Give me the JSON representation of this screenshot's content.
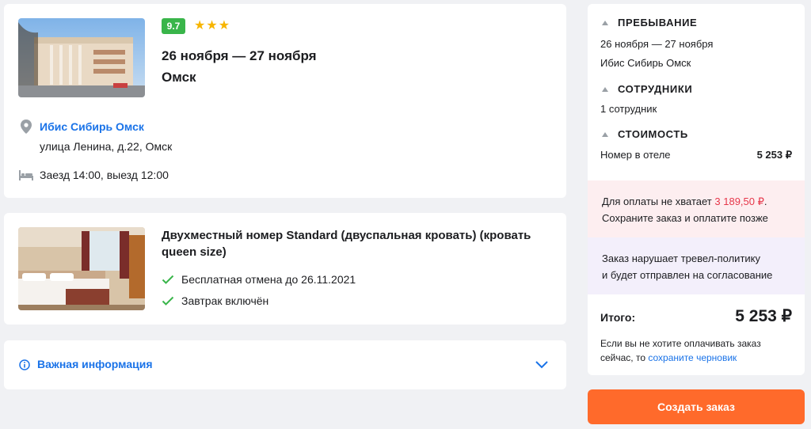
{
  "hotel": {
    "rating": "9.7",
    "stars": 3,
    "dates": "26 ноября — 27 ноября",
    "city": "Омск",
    "name": "Ибис Сибирь Омск",
    "address": "улица Ленина, д.22, Омск",
    "checkin": "Заезд 14:00, выезд 12:00"
  },
  "room": {
    "title": "Двухместный номер Standard (двуспальная кровать) (кровать queen size)",
    "features": [
      "Бесплатная отмена до 26.11.2021",
      "Завтрак включён"
    ]
  },
  "info": {
    "label": "Важная информация"
  },
  "summary": {
    "stay_heading": "ПРЕБЫВАНИЕ",
    "stay_dates": "26 ноября — 27 ноября",
    "stay_hotel": "Ибис Сибирь Омск",
    "staff_heading": "СОТРУДНИКИ",
    "staff_count": "1 сотрудник",
    "cost_heading": "СТОИМОСТЬ",
    "cost_label": "Номер в отеле",
    "cost_value": "5 253 ₽",
    "insufficient_prefix": "Для оплаты не хватает ",
    "insufficient_amount": "3 189,50 ₽",
    "insufficient_suffix": ".",
    "insufficient_line2": "Сохраните заказ и оплатите позже",
    "policy_line1": "Заказ нарушает тревел-политику",
    "policy_line2": "и будет отправлен на согласование",
    "total_label": "Итого:",
    "total_value": "5 253 ₽",
    "note_text": "Если вы не хотите оплачивать заказ сейчас, то ",
    "note_link": "сохраните черновик"
  },
  "create_button": "Создать заказ",
  "colors": {
    "accent_blue": "#1a73e8",
    "rating_green": "#39b54a",
    "star_yellow": "#f7b500",
    "button_orange": "#ff6a2b",
    "warning_red": "#e6374a"
  }
}
